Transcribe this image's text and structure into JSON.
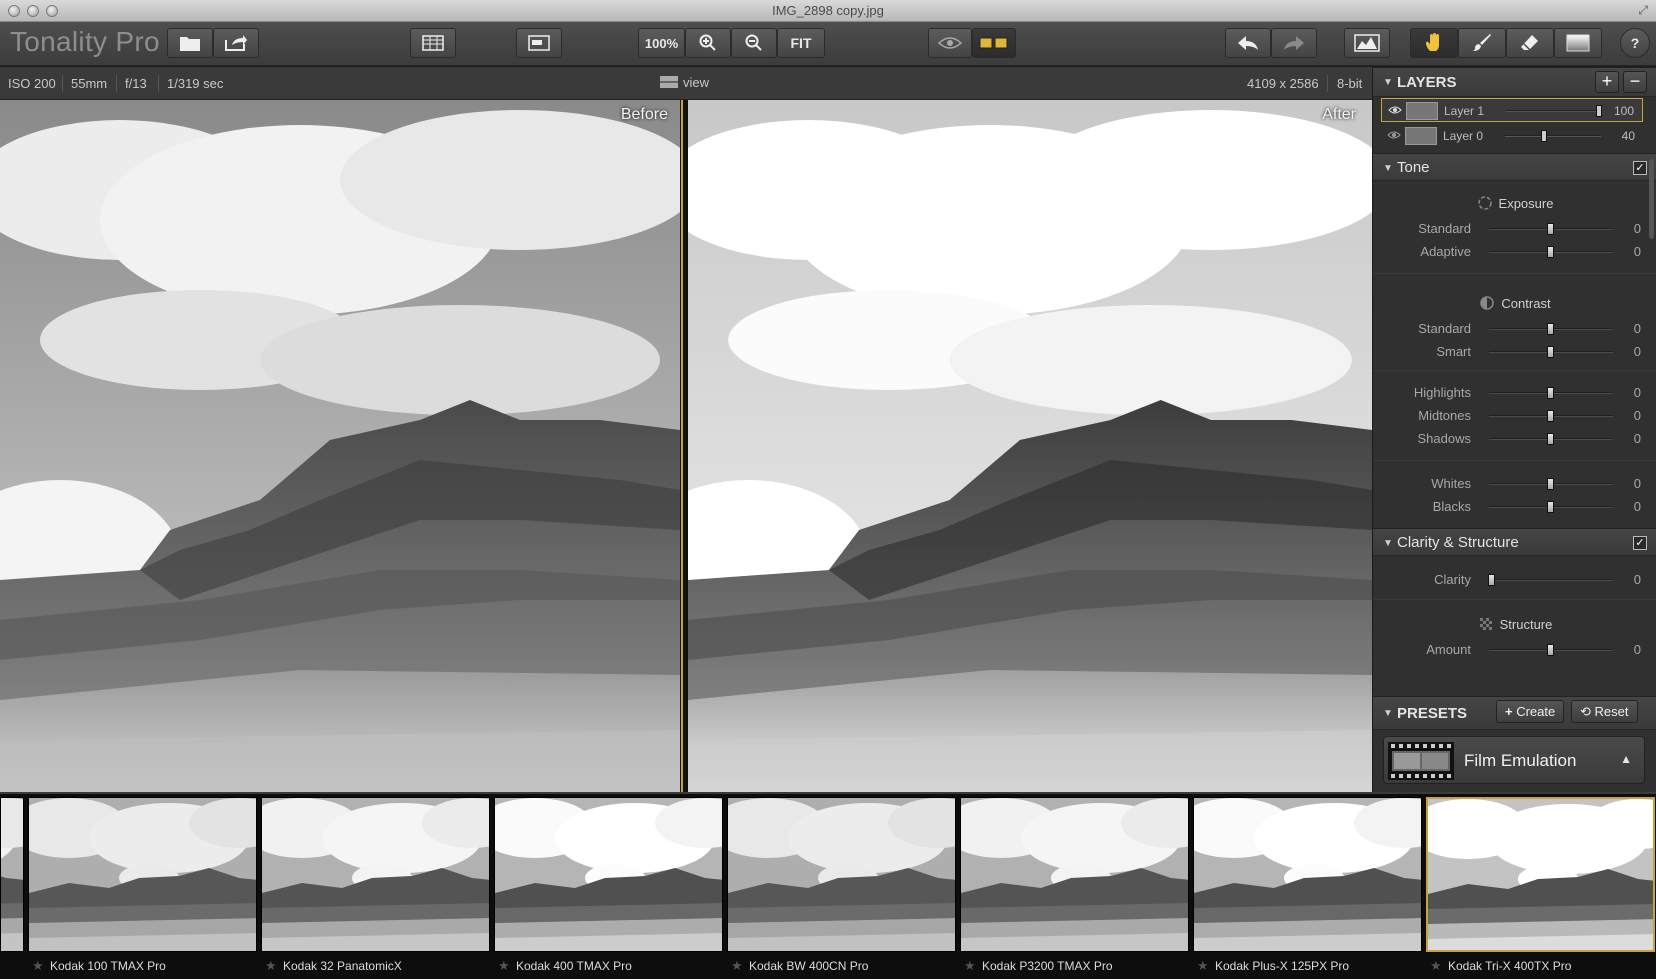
{
  "window": {
    "title": "IMG_2898 copy.jpg"
  },
  "app": {
    "name": "Tonality Pro"
  },
  "toolbar": {
    "zoom_level": "100%",
    "fit_label": "FIT"
  },
  "info": {
    "iso": "ISO 200",
    "focal_length": "55mm",
    "aperture": "f/13",
    "shutter": "1/319 sec",
    "view_label": "view",
    "dimensions": "4109 x 2586",
    "bit_depth": "8-bit"
  },
  "preview": {
    "before_label": "Before",
    "after_label": "After"
  },
  "layers": {
    "title": "LAYERS",
    "add": "+",
    "remove": "−",
    "items": [
      {
        "name": "Layer 1",
        "opacity": 100,
        "value": "100",
        "selected": true
      },
      {
        "name": "Layer 0",
        "opacity": 40,
        "value": "40",
        "selected": false
      }
    ]
  },
  "tone": {
    "title": "Tone",
    "checked": "✓",
    "exposure": {
      "title": "Exposure",
      "sliders": [
        {
          "label": "Standard",
          "value": "0"
        },
        {
          "label": "Adaptive",
          "value": "0"
        }
      ]
    },
    "contrast": {
      "title": "Contrast",
      "sliders": [
        {
          "label": "Standard",
          "value": "0"
        },
        {
          "label": "Smart",
          "value": "0"
        }
      ]
    },
    "ranges": [
      {
        "label": "Highlights",
        "value": "0"
      },
      {
        "label": "Midtones",
        "value": "0"
      },
      {
        "label": "Shadows",
        "value": "0"
      }
    ],
    "endpoints": [
      {
        "label": "Whites",
        "value": "0"
      },
      {
        "label": "Blacks",
        "value": "0"
      }
    ]
  },
  "clarity": {
    "title": "Clarity & Structure",
    "checked": "✓",
    "clarity_slider": {
      "label": "Clarity",
      "value": "0"
    },
    "structure": {
      "title": "Structure",
      "amount": {
        "label": "Amount",
        "value": "0"
      }
    }
  },
  "presets": {
    "title": "PRESETS",
    "create_label": "Create",
    "reset_label": "Reset",
    "category": "Film Emulation",
    "items": [
      {
        "name": "Kodak 100 TMAX Pro",
        "selected": false
      },
      {
        "name": "Kodak 32 PanatomicX",
        "selected": false
      },
      {
        "name": "Kodak 400 TMAX Pro",
        "selected": false
      },
      {
        "name": "Kodak BW 400CN Pro",
        "selected": false
      },
      {
        "name": "Kodak P3200 TMAX Pro",
        "selected": false
      },
      {
        "name": "Kodak Plus-X 125PX Pro",
        "selected": false
      },
      {
        "name": "Kodak Tri-X 400TX Pro",
        "selected": true
      }
    ]
  },
  "colors": {
    "accent": "#c9a33a",
    "panel_bg": "#303030",
    "toolbar_bg": "#444444"
  }
}
